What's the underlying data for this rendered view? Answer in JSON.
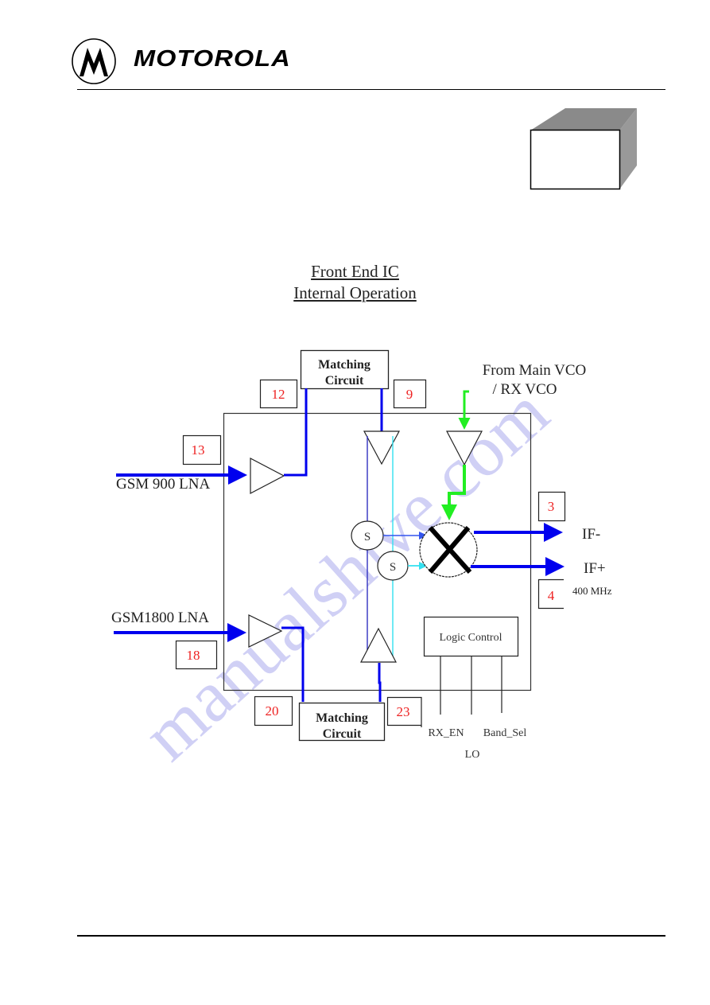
{
  "header": {
    "brand_name": "MOTOROLA",
    "logo_icon": "motorola-batwing-logo-icon"
  },
  "decoration": {
    "box_icon": "3d-box-icon",
    "watermark": "manualshive.com"
  },
  "diagram": {
    "title_line1": "Front End IC",
    "title_line2": "Internal Operation",
    "blocks": {
      "matching_top": [
        "Matching",
        "Circuit"
      ],
      "matching_bottom": [
        "Matching",
        "Circuit"
      ],
      "logic_control": "Logic Control",
      "switch_1": "S",
      "switch_2": "S"
    },
    "pins": {
      "p12": "12",
      "p9": "9",
      "p13": "13",
      "p18": "18",
      "p3": "3",
      "p4": "4",
      "p20": "20",
      "p23": "23"
    },
    "labels": {
      "gsm900": "GSM 900 LNA",
      "gsm1800": "GSM1800 LNA",
      "vco_line1": "From Main VCO",
      "vco_line2": "/ RX VCO",
      "if_minus": "IF-",
      "if_plus": "IF+",
      "if_freq": "400 MHz",
      "rx_en": "RX_EN",
      "lo": "LO",
      "band_sel": "Band_Sel"
    },
    "colors": {
      "signal_blue": "#0000ee",
      "lo_green": "#22ee22",
      "cyan_path": "#33e0f0",
      "pin_number_red": "#ee2222",
      "watermark": "#c8c8f4"
    }
  }
}
